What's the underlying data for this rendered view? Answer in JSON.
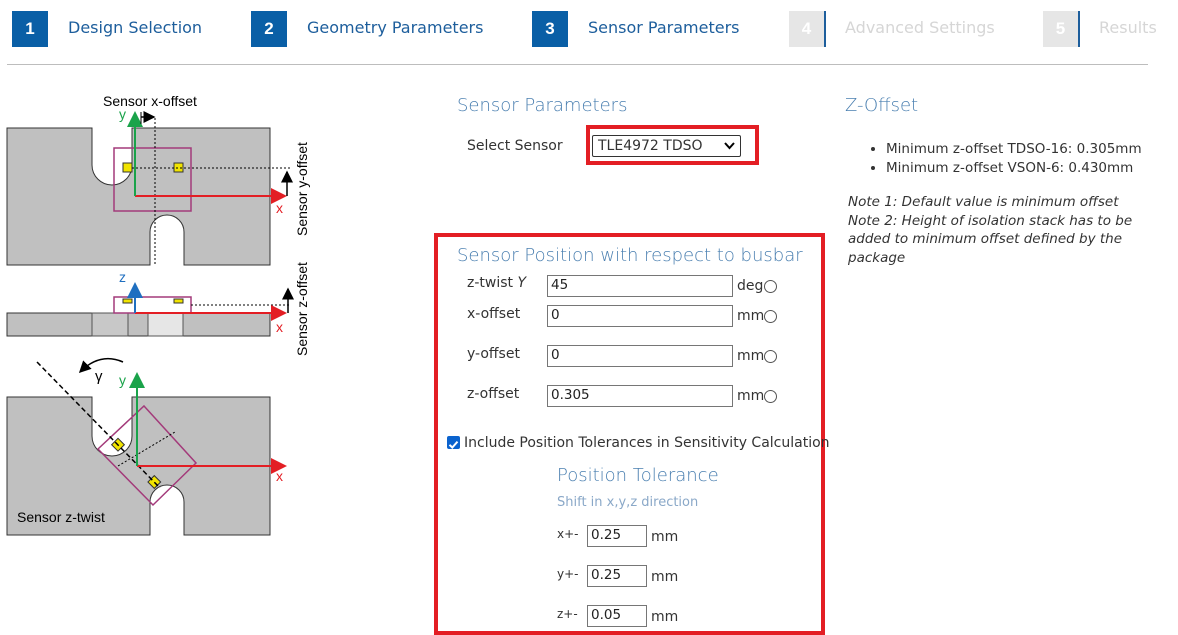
{
  "stepper": [
    {
      "num": "1",
      "label": "Design Selection",
      "state": "active"
    },
    {
      "num": "2",
      "label": "Geometry Parameters",
      "state": "active"
    },
    {
      "num": "3",
      "label": "Sensor Parameters",
      "state": "active"
    },
    {
      "num": "4",
      "label": "Advanced Settings",
      "state": "disabled"
    },
    {
      "num": "5",
      "label": "Results",
      "state": "disabled"
    }
  ],
  "sensor_params": {
    "title": "Sensor Parameters",
    "select_label": "Select Sensor",
    "select_value": "TLE4972 TDSO"
  },
  "position": {
    "title": "Sensor Position with respect to busbar",
    "rows": [
      {
        "label": "z-twist",
        "symbol": "Y",
        "value": "45",
        "unit": "deg"
      },
      {
        "label": "x-offset",
        "value": "0",
        "unit": "mm"
      },
      {
        "label": "y-offset",
        "value": "0",
        "unit": "mm"
      },
      {
        "label": "z-offset",
        "value": "0.305",
        "unit": "mm"
      }
    ],
    "checkbox_label": "Include Position Tolerances in Sensitivity Calculation",
    "checkbox_checked": true
  },
  "tolerance": {
    "title": "Position Tolerance",
    "subtitle": "Shift in x,y,z direction",
    "rows": [
      {
        "label": "x+-",
        "value": "0.25",
        "unit": "mm"
      },
      {
        "label": "y+-",
        "value": "0.25",
        "unit": "mm"
      },
      {
        "label": "z+-",
        "value": "0.05",
        "unit": "mm"
      }
    ]
  },
  "zoffset": {
    "title": "Z-Offset",
    "items": [
      "Minimum z-offset TDSO-16: 0.305mm",
      "Minimum z-offset VSON-6: 0.430mm"
    ],
    "notes": [
      "Note 1: Default value is minimum offset",
      "Note 2: Height of isolation stack has to be",
      "added to minimum offset defined by the",
      "package"
    ]
  },
  "diagram": {
    "x_offset_label": "Sensor x-offset",
    "y_offset_label": "Sensor y-offset",
    "z_offset_label": "Sensor z-offset",
    "z_twist_label": "Sensor z-twist",
    "axis_x": "x",
    "axis_y": "y",
    "axis_z": "z",
    "gamma": "γ"
  },
  "colors": {
    "accent": "#0a5fa6",
    "highlight": "#e31e24",
    "title_blue": "#4a7fb0"
  }
}
